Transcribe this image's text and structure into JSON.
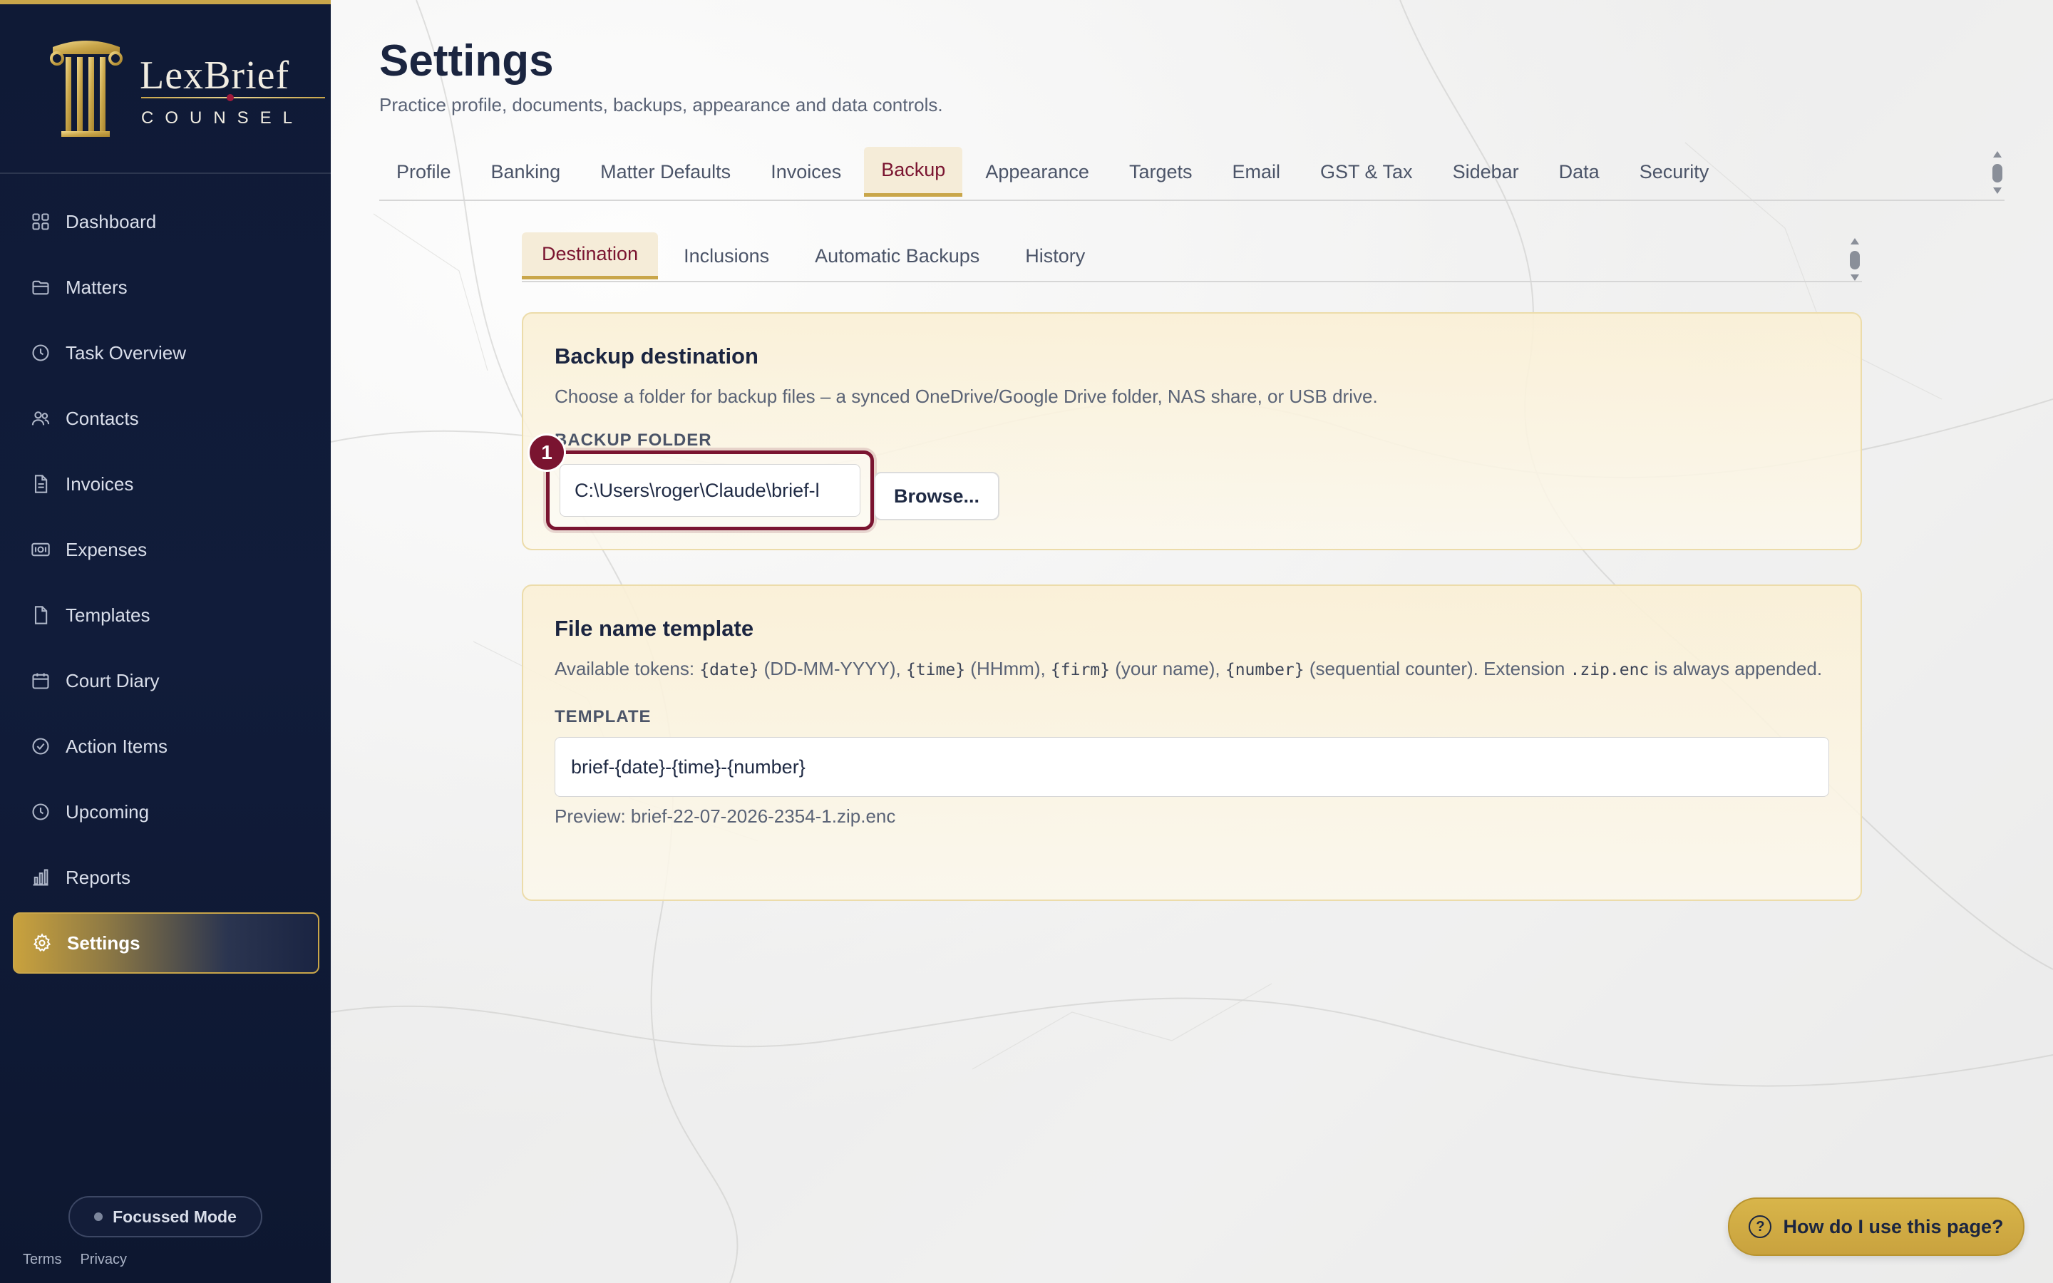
{
  "brand": {
    "name": "LexBrief",
    "subtitle": "COUNSEL"
  },
  "sidebar": {
    "items": [
      {
        "label": "Dashboard",
        "icon": "grid-icon"
      },
      {
        "label": "Matters",
        "icon": "folder-icon"
      },
      {
        "label": "Task Overview",
        "icon": "clock-icon"
      },
      {
        "label": "Contacts",
        "icon": "users-icon"
      },
      {
        "label": "Invoices",
        "icon": "document-icon"
      },
      {
        "label": "Expenses",
        "icon": "banknote-icon"
      },
      {
        "label": "Templates",
        "icon": "file-icon"
      },
      {
        "label": "Court Diary",
        "icon": "calendar-icon"
      },
      {
        "label": "Action Items",
        "icon": "check-circle-icon"
      },
      {
        "label": "Upcoming",
        "icon": "clock-icon"
      },
      {
        "label": "Reports",
        "icon": "bar-chart-icon"
      },
      {
        "label": "Settings",
        "icon": "gear-icon",
        "active": true
      }
    ],
    "focus_mode": "Focussed Mode",
    "terms": "Terms",
    "privacy": "Privacy"
  },
  "page": {
    "title": "Settings",
    "subtitle": "Practice profile, documents, backups, appearance and data controls."
  },
  "tabs": [
    "Profile",
    "Banking",
    "Matter Defaults",
    "Invoices",
    "Backup",
    "Appearance",
    "Targets",
    "Email",
    "GST & Tax",
    "Sidebar",
    "Data",
    "Security"
  ],
  "active_tab": "Backup",
  "subtabs": [
    "Destination",
    "Inclusions",
    "Automatic Backups",
    "History"
  ],
  "active_subtab": "Destination",
  "backup_destination": {
    "title": "Backup destination",
    "description": "Choose a folder for backup files – a synced OneDrive/Google Drive folder, NAS share, or USB drive.",
    "field_label": "BACKUP FOLDER",
    "folder_value": "C:\\Users\\roger\\Claude\\brief-l",
    "step_badge": "1",
    "browse_label": "Browse..."
  },
  "file_name_template": {
    "title": "File name template",
    "desc_prefix": "Available tokens: ",
    "token_date": "{date}",
    "desc_date": " (DD-MM-YYYY), ",
    "token_time": "{time}",
    "desc_time": " (HHmm), ",
    "token_firm": "{firm}",
    "desc_firm": " (your name), ",
    "token_number": "{number}",
    "desc_number": " (sequential counter). Extension ",
    "extension": ".zip.enc",
    "desc_suffix": " is always appended.",
    "field_label": "TEMPLATE",
    "template_value": "brief-{date}-{time}-{number}",
    "preview": "Preview: brief-22-07-2026-2354-1.zip.enc"
  },
  "help": {
    "label": "How do I use this page?",
    "icon_glyph": "?"
  },
  "colors": {
    "sidebar_bg": "#0f1a36",
    "accent_gold": "#c9a64a",
    "accent_maroon": "#7a1430"
  }
}
